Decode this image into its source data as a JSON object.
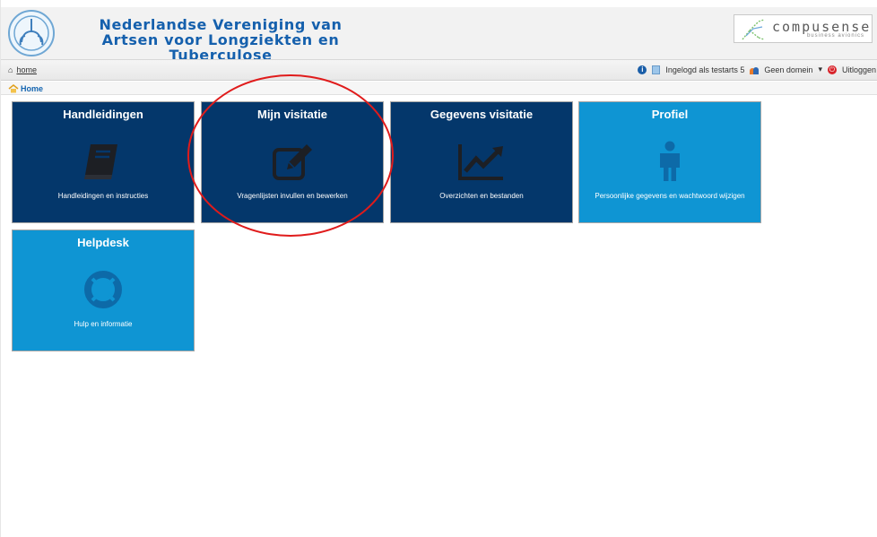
{
  "header": {
    "org_name_line1": "Nederlandse Vereniging van",
    "org_name_line2": "Artsen voor Longziekten en Tuberculose",
    "brand_name": "compusense",
    "brand_sub": "business avionics"
  },
  "navbar": {
    "home_link": "home",
    "user_label": "Ingelogd als testarts 5",
    "domain_label": "Geen domein",
    "logout_label": "Uitloggen"
  },
  "breadcrumb": {
    "label": "Home"
  },
  "tiles": [
    {
      "title": "Handleidingen",
      "subtitle": "Handleidingen en instructies",
      "icon": "book-icon",
      "style": "dark"
    },
    {
      "title": "Mijn visitatie",
      "subtitle": "Vragenlijsten invullen en bewerken",
      "icon": "edit-icon",
      "style": "dark"
    },
    {
      "title": "Gegevens visitatie",
      "subtitle": "Overzichten en bestanden",
      "icon": "chart-line-icon",
      "style": "dark"
    },
    {
      "title": "Profiel",
      "subtitle": "Persoonlijke gegevens en wachtwoord wijzigen",
      "icon": "person-icon",
      "style": "light"
    },
    {
      "title": "Helpdesk",
      "subtitle": "Hulp en informatie",
      "icon": "lifebuoy-icon",
      "style": "light"
    }
  ],
  "colors": {
    "tile_dark": "#04376b",
    "tile_light": "#0f95d3",
    "org_name": "#1560ad",
    "annotation": "#e01b1b"
  }
}
